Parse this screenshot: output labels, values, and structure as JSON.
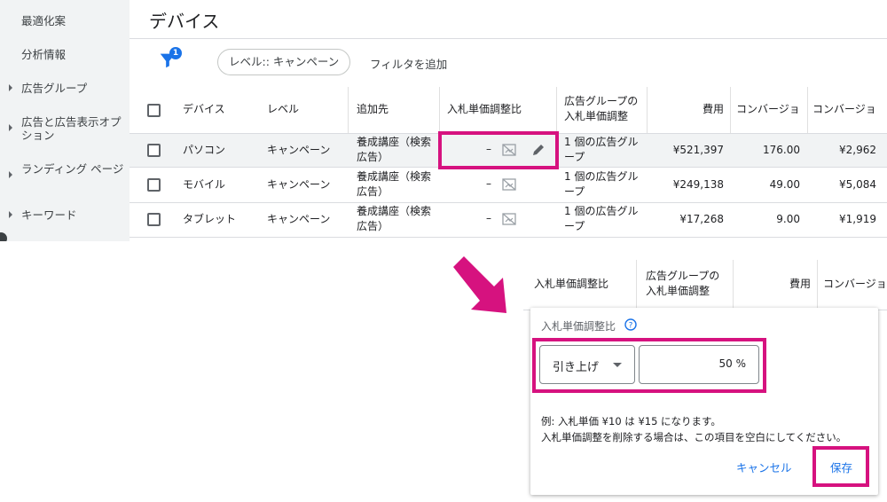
{
  "sidebar": {
    "items": [
      {
        "label": "最適化案",
        "expandable": false
      },
      {
        "label": "分析情報",
        "expandable": false
      },
      {
        "label": "広告グループ",
        "expandable": true
      },
      {
        "label": "広告と広告表示オプション",
        "expandable": true
      },
      {
        "label": "ランディング ページ",
        "expandable": true
      },
      {
        "label": "キーワード",
        "expandable": true
      }
    ]
  },
  "page": {
    "title": "デバイス"
  },
  "filters": {
    "badge": "1",
    "chip": "レベル:: キャンペーン",
    "add": "フィルタを追加"
  },
  "table": {
    "headers": [
      "デバイス",
      "レベル",
      "追加先",
      "入札単価調整比",
      "広告グループの 入札単価調整",
      "費用",
      "コンバージョ",
      "コンバージョ"
    ],
    "rows": [
      {
        "device": "パソコン",
        "level": "キャンペーン",
        "added_to": "養成講座（検索広告）",
        "bid_adj": "–",
        "adgroup_bid": "1 個の広告グループ",
        "cost": "¥521,397",
        "conversions": "176.00",
        "cost_per_conv": "¥2,962"
      },
      {
        "device": "モバイル",
        "level": "キャンペーン",
        "added_to": "養成講座（検索広告）",
        "bid_adj": "–",
        "adgroup_bid": "1 個の広告グループ",
        "cost": "¥249,138",
        "conversions": "49.00",
        "cost_per_conv": "¥5,084"
      },
      {
        "device": "タブレット",
        "level": "キャンペーン",
        "added_to": "養成講座（検索広告）",
        "bid_adj": "–",
        "adgroup_bid": "1 個の広告グループ",
        "cost": "¥17,268",
        "conversions": "9.00",
        "cost_per_conv": "¥1,919"
      }
    ]
  },
  "zoom": {
    "headers": [
      "入札単価調整比",
      "広告グループの 入札単価調整",
      "費用",
      "コンバージョ"
    ],
    "editor": {
      "title": "入札単価調整比",
      "direction": "引き上げ",
      "percent": "50",
      "percent_unit": "%",
      "example": "例: 入札単価 ¥10 は ¥15 になります。",
      "note": "入札単価調整を削除する場合は、この項目を空白にしてください。",
      "cancel": "キャンセル",
      "save": "保存"
    }
  },
  "colors": {
    "highlight": "#d6127f",
    "accent": "#1a73e8"
  },
  "icons": [
    "filter-icon",
    "no-image-icon",
    "pencil-icon",
    "help-icon",
    "dropdown-caret-icon",
    "arrow-icon"
  ]
}
